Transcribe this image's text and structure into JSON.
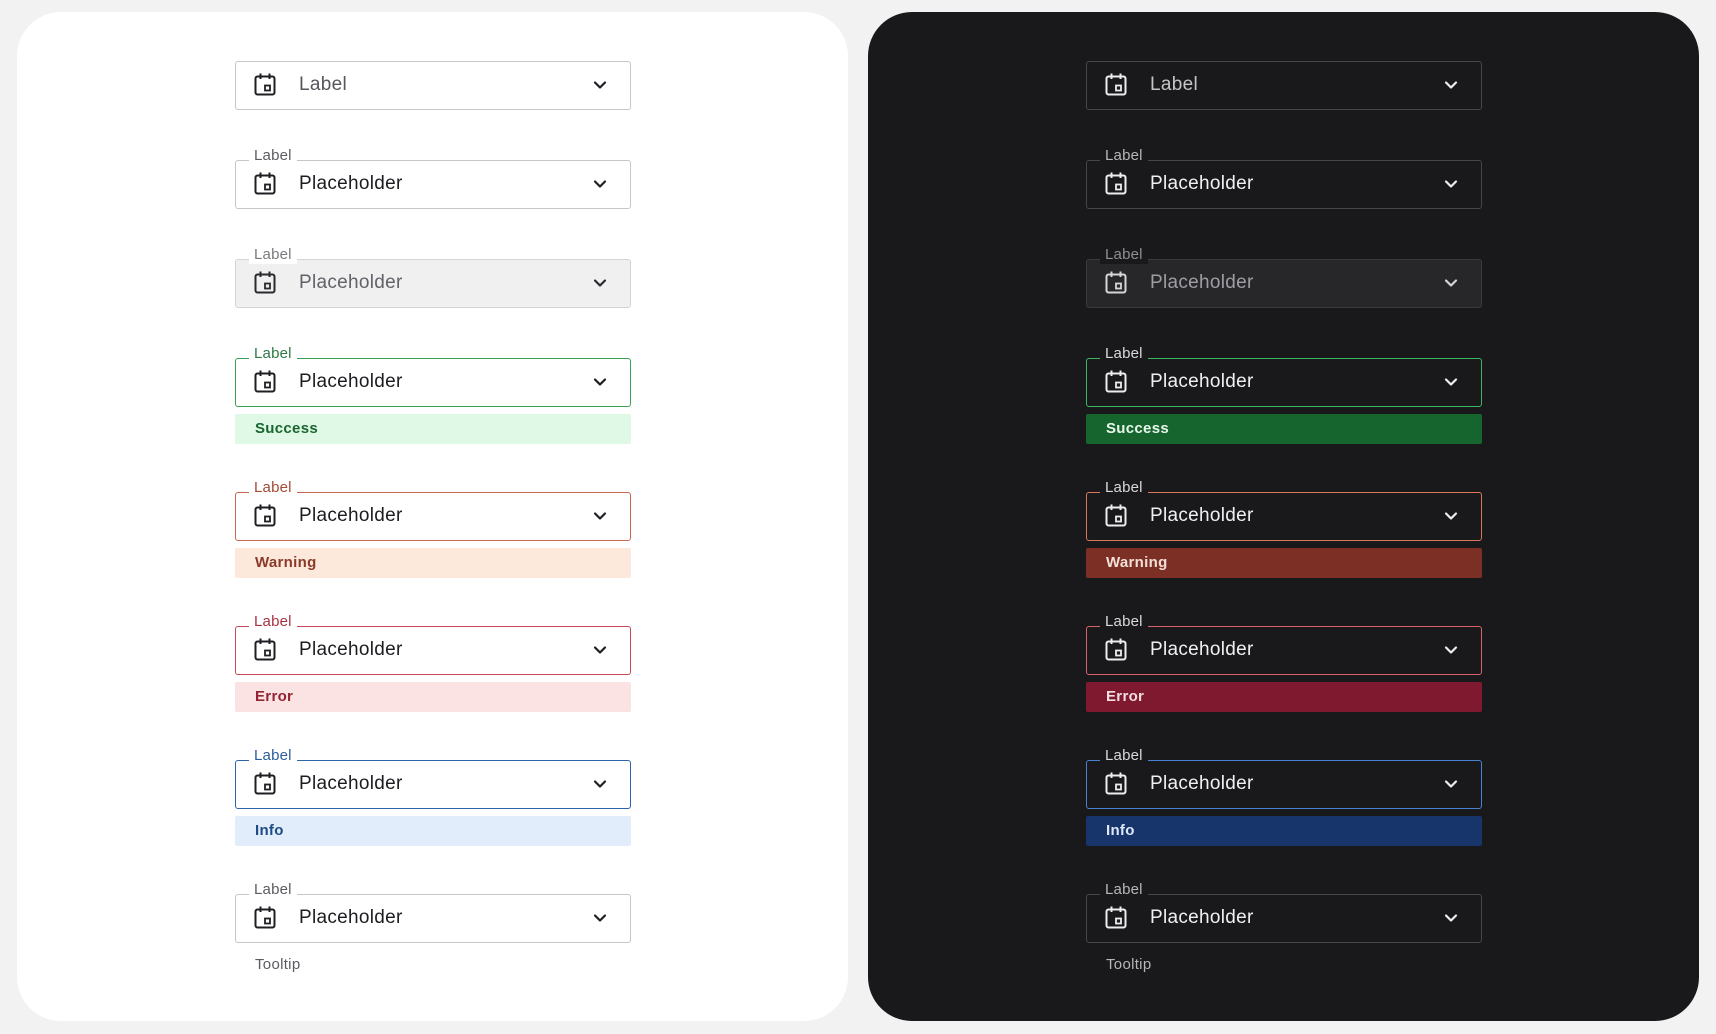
{
  "colors": {
    "page_background": "#f2f2f3",
    "light_panel": "#ffffff",
    "dark_panel": "#19191b",
    "success": "#3aa257",
    "warning": "#c6684e",
    "error": "#c54a57",
    "info": "#2f64ab"
  },
  "icons": {
    "leading": "calendar-icon",
    "trailing": "chevron-down-icon"
  },
  "light": {
    "fields": [
      {
        "state": "default-empty",
        "value": "Label"
      },
      {
        "state": "default",
        "label": "Label",
        "value": "Placeholder"
      },
      {
        "state": "disabled",
        "label": "Label",
        "value": "Placeholder"
      },
      {
        "state": "success",
        "label": "Label",
        "value": "Placeholder",
        "message": "Success"
      },
      {
        "state": "warning",
        "label": "Label",
        "value": "Placeholder",
        "message": "Warning"
      },
      {
        "state": "error",
        "label": "Label",
        "value": "Placeholder",
        "message": "Error"
      },
      {
        "state": "info",
        "label": "Label",
        "value": "Placeholder",
        "message": "Info"
      },
      {
        "state": "tooltip",
        "label": "Label",
        "value": "Placeholder",
        "tooltip": "Tooltip"
      }
    ]
  },
  "dark": {
    "fields": [
      {
        "state": "default-empty",
        "value": "Label"
      },
      {
        "state": "default",
        "label": "Label",
        "value": "Placeholder"
      },
      {
        "state": "disabled",
        "label": "Label",
        "value": "Placeholder"
      },
      {
        "state": "success",
        "label": "Label",
        "value": "Placeholder",
        "message": "Success"
      },
      {
        "state": "warning",
        "label": "Label",
        "value": "Placeholder",
        "message": "Warning"
      },
      {
        "state": "error",
        "label": "Label",
        "value": "Placeholder",
        "message": "Error"
      },
      {
        "state": "info",
        "label": "Label",
        "value": "Placeholder",
        "message": "Info"
      },
      {
        "state": "tooltip",
        "label": "Label",
        "value": "Placeholder",
        "tooltip": "Tooltip"
      }
    ]
  }
}
